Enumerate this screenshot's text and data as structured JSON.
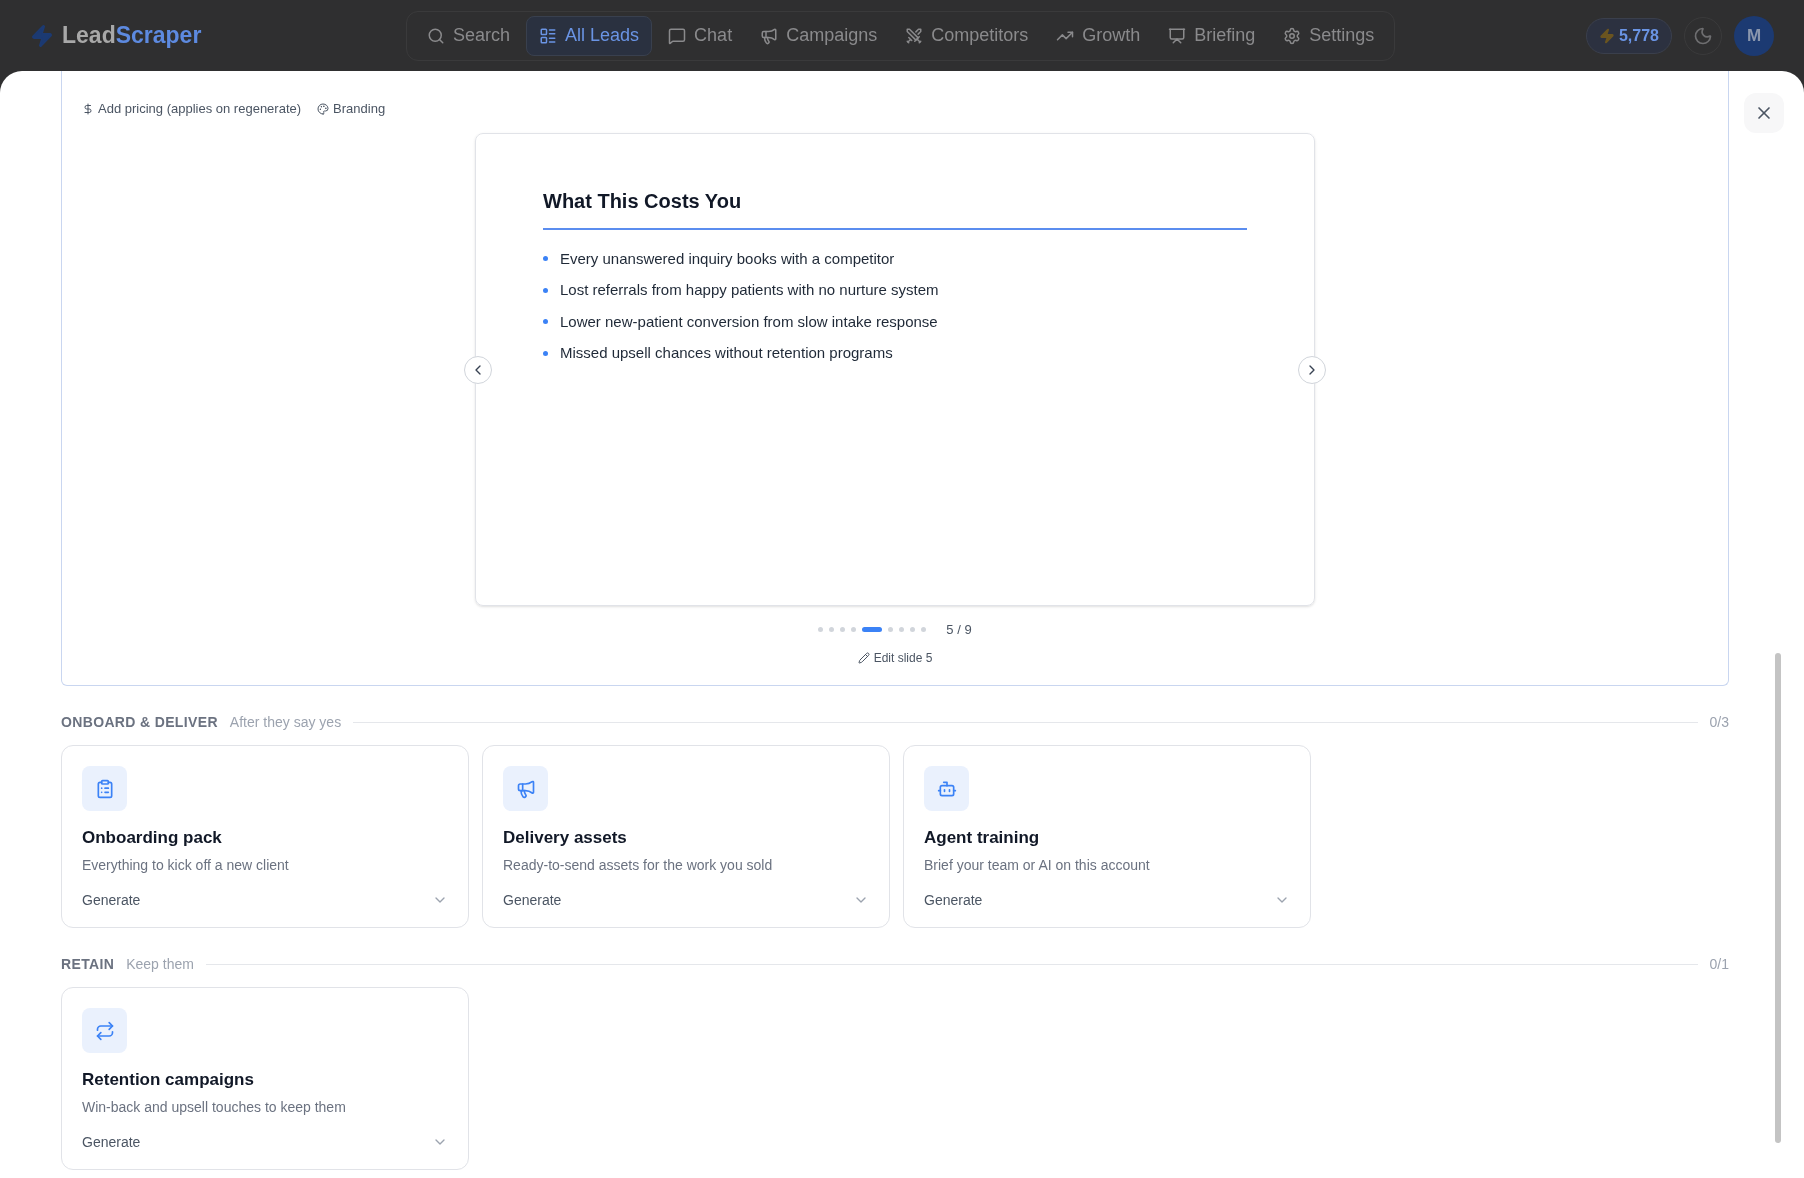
{
  "nav": {
    "brand": {
      "part_1": "Lead",
      "part_2": "Scraper"
    },
    "items": [
      {
        "label": "Search",
        "selected": false
      },
      {
        "label": "All Leads",
        "selected": true
      },
      {
        "label": "Chat",
        "selected": false
      },
      {
        "label": "Campaigns",
        "selected": false
      },
      {
        "label": "Competitors",
        "selected": false
      },
      {
        "label": "Growth",
        "selected": false
      },
      {
        "label": "Briefing",
        "selected": false
      },
      {
        "label": "Settings",
        "selected": false
      }
    ],
    "credits": "5,778",
    "avatar": "M"
  },
  "toolbar": [
    "Add pricing (applies on regenerate)",
    "Branding"
  ],
  "slide": {
    "title": "What This Costs You",
    "bullets": [
      "Every unanswered inquiry books with a competitor",
      "Lost referrals from happy patients with no nurture system",
      "Lower new-patient conversion from slow intake response",
      "Missed upsell chances without retention programs"
    ],
    "dots": [
      {
        "selected": false
      },
      {
        "selected": false
      },
      {
        "selected": false
      },
      {
        "selected": false
      },
      {
        "selected": true
      },
      {
        "selected": false
      },
      {
        "selected": false
      },
      {
        "selected": false
      },
      {
        "selected": false
      }
    ],
    "counter": "5 / 9",
    "edit": "Edit slide 5"
  },
  "sections": [
    {
      "title": "ONBOARD & DELIVER",
      "subtitle": "After they say yes",
      "count": "0/3",
      "cards": [
        {
          "title": "Onboarding pack",
          "description": "Everything to kick off a new client",
          "action": "Generate"
        },
        {
          "title": "Delivery assets",
          "description": "Ready-to-send assets for the work you sold",
          "action": "Generate"
        },
        {
          "title": "Agent training",
          "description": "Brief your team or AI on this account",
          "action": "Generate"
        }
      ]
    },
    {
      "title": "RETAIN",
      "subtitle": "Keep them",
      "count": "0/1",
      "cards": [
        {
          "title": "Retention campaigns",
          "description": "Win-back and upsell touches to keep them",
          "action": "Generate"
        }
      ]
    }
  ]
}
